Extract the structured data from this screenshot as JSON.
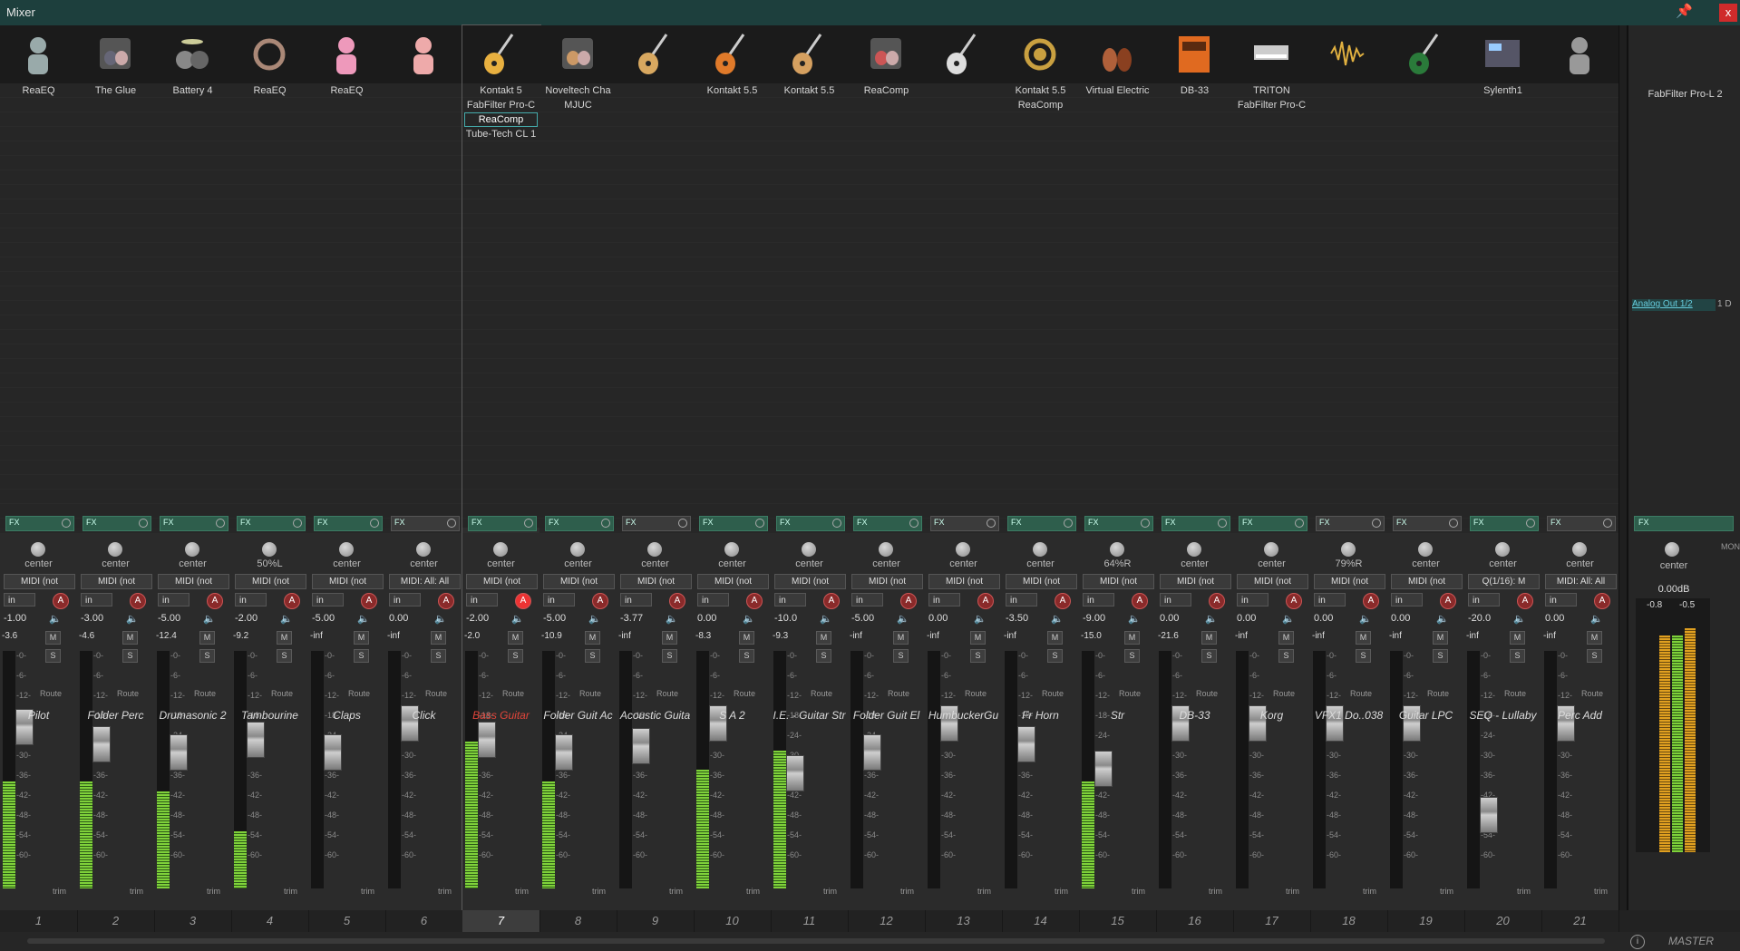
{
  "window": {
    "title": "Mixer",
    "pin_icon": "pin-icon",
    "close_label": "x"
  },
  "tracks": [
    {
      "num": "1",
      "name": "Pilot",
      "fx": [
        "ReaEQ"
      ],
      "pan": "center",
      "midi": "MIDI (not",
      "vol": "-1.00",
      "peak": "-3.6",
      "armed": false,
      "meter": 0.45,
      "fader": 0.72,
      "icon": "mic",
      "fxon": true
    },
    {
      "num": "2",
      "name": "Folder Perc",
      "fx": [
        "The Glue"
      ],
      "pan": "center",
      "midi": "MIDI (not",
      "vol": "-3.00",
      "peak": "-4.6",
      "armed": false,
      "meter": 0.45,
      "fader": 0.64,
      "icon": "band",
      "fxon": true
    },
    {
      "num": "3",
      "name": "Drumasonic 2",
      "fx": [
        "Battery 4"
      ],
      "pan": "center",
      "midi": "MIDI (not",
      "vol": "-5.00",
      "peak": "-12.4",
      "armed": false,
      "meter": 0.41,
      "fader": 0.6,
      "icon": "drums",
      "fxon": true
    },
    {
      "num": "4",
      "name": "Tambourine",
      "fx": [
        "ReaEQ"
      ],
      "pan": "50%L",
      "midi": "MIDI (not",
      "vol": "-2.00",
      "peak": "-9.2",
      "armed": false,
      "meter": 0.24,
      "fader": 0.66,
      "icon": "tamb",
      "fxon": true
    },
    {
      "num": "5",
      "name": "Claps",
      "fx": [
        "ReaEQ"
      ],
      "pan": "center",
      "midi": "MIDI (not",
      "vol": "-5.00",
      "peak": "-inf",
      "armed": false,
      "meter": 0.0,
      "fader": 0.6,
      "icon": "claps",
      "fxon": true
    },
    {
      "num": "6",
      "name": "Click",
      "fx": [],
      "pan": "center",
      "midi": "MIDI: All: All",
      "vol": "0.00",
      "peak": "-inf",
      "armed": false,
      "meter": 0.0,
      "fader": 0.74,
      "icon": "hand",
      "fxon": false
    },
    {
      "num": "7",
      "name": "Bass Guitar",
      "fx": [
        "Kontakt 5",
        "FabFilter Pro-C",
        "ReaComp",
        "Tube-Tech CL 1"
      ],
      "pan": "center",
      "midi": "MIDI (not",
      "vol": "-2.00",
      "peak": "-2.0",
      "armed": true,
      "meter": 0.62,
      "fader": 0.66,
      "icon": "bass",
      "fxon": true
    },
    {
      "num": "8",
      "name": "Folder Guit Ac",
      "fx": [
        "Noveltech Cha",
        "MJUC"
      ],
      "pan": "center",
      "midi": "MIDI (not",
      "vol": "-5.00",
      "peak": "-10.9",
      "armed": false,
      "meter": 0.45,
      "fader": 0.6,
      "icon": "guitars",
      "fxon": true
    },
    {
      "num": "9",
      "name": "Acoustic Guita",
      "fx": [],
      "pan": "center",
      "midi": "MIDI (not",
      "vol": "-3.77",
      "peak": "-inf",
      "armed": false,
      "meter": 0.0,
      "fader": 0.63,
      "icon": "acoustic",
      "fxon": false
    },
    {
      "num": "10",
      "name": "S A 2",
      "fx": [
        "Kontakt 5.5"
      ],
      "pan": "center",
      "midi": "MIDI (not",
      "vol": "0.00",
      "peak": "-8.3",
      "armed": false,
      "meter": 0.5,
      "fader": 0.74,
      "icon": "orange",
      "fxon": true
    },
    {
      "num": "11",
      "name": "I.E. - Guitar Str",
      "fx": [
        "Kontakt 5.5"
      ],
      "pan": "center",
      "midi": "MIDI (not",
      "vol": "-10.0",
      "peak": "-9.3",
      "armed": false,
      "meter": 0.58,
      "fader": 0.5,
      "icon": "acoustic2",
      "fxon": true
    },
    {
      "num": "12",
      "name": "Folder Guit El",
      "fx": [
        "ReaComp"
      ],
      "pan": "center",
      "midi": "MIDI (not",
      "vol": "-5.00",
      "peak": "-inf",
      "armed": false,
      "meter": 0.0,
      "fader": 0.6,
      "icon": "electric",
      "fxon": true
    },
    {
      "num": "13",
      "name": "HumbuckerGu",
      "fx": [],
      "pan": "center",
      "midi": "MIDI (not",
      "vol": "0.00",
      "peak": "-inf",
      "armed": false,
      "meter": 0.0,
      "fader": 0.74,
      "icon": "strat",
      "fxon": false
    },
    {
      "num": "14",
      "name": "Fr Horn",
      "fx": [
        "Kontakt 5.5",
        "ReaComp"
      ],
      "pan": "center",
      "midi": "MIDI (not",
      "vol": "-3.50",
      "peak": "-inf",
      "armed": false,
      "meter": 0.0,
      "fader": 0.64,
      "icon": "horn",
      "fxon": true
    },
    {
      "num": "15",
      "name": "Str",
      "fx": [
        "Virtual Electric"
      ],
      "pan": "64%R",
      "midi": "MIDI (not",
      "vol": "-9.00",
      "peak": "-15.0",
      "armed": false,
      "meter": 0.45,
      "fader": 0.52,
      "icon": "strings",
      "fxon": true
    },
    {
      "num": "16",
      "name": "DB-33",
      "fx": [
        "DB-33"
      ],
      "pan": "center",
      "midi": "MIDI (not",
      "vol": "0.00",
      "peak": "-21.6",
      "armed": false,
      "meter": 0.0,
      "fader": 0.74,
      "icon": "organ",
      "fxon": true
    },
    {
      "num": "17",
      "name": "Korg",
      "fx": [
        "TRITON",
        "FabFilter Pro-C"
      ],
      "pan": "center",
      "midi": "MIDI (not",
      "vol": "0.00",
      "peak": "-inf",
      "armed": false,
      "meter": 0.0,
      "fader": 0.74,
      "icon": "keys",
      "fxon": true
    },
    {
      "num": "18",
      "name": "VFX1 Do..038",
      "fx": [],
      "pan": "79%R",
      "midi": "MIDI (not",
      "vol": "0.00",
      "peak": "-inf",
      "armed": false,
      "meter": 0.0,
      "fader": 0.74,
      "icon": "wave",
      "fxon": false
    },
    {
      "num": "19",
      "name": "Guitar LPC",
      "fx": [],
      "pan": "center",
      "midi": "MIDI (not",
      "vol": "0.00",
      "peak": "-inf",
      "armed": false,
      "meter": 0.0,
      "fader": 0.74,
      "icon": "lp",
      "fxon": false
    },
    {
      "num": "20",
      "name": "SEQ - Lullaby",
      "fx": [
        "Sylenth1"
      ],
      "pan": "center",
      "midi": "Q(1/16): M",
      "vol": "-20.0",
      "peak": "-inf",
      "armed": false,
      "meter": 0.0,
      "fader": 0.3,
      "icon": "synth",
      "fxon": true
    },
    {
      "num": "21",
      "name": "Perc Add",
      "fx": [],
      "pan": "center",
      "midi": "MIDI: All: All",
      "vol": "0.00",
      "peak": "-inf",
      "armed": false,
      "meter": 0.0,
      "fader": 0.74,
      "icon": "person",
      "fxon": false
    }
  ],
  "labels": {
    "fx": "FX",
    "in": "in",
    "route": "Route",
    "trim": "trim",
    "M": "M",
    "S": "S",
    "arm": "A"
  },
  "scale": [
    "-0-",
    "-6-",
    "-12-",
    "-18-",
    "-24-",
    "-30-",
    "-36-",
    "-42-",
    "-48-",
    "-54-",
    "-60-"
  ],
  "master": {
    "fx": "FabFilter Pro-L 2",
    "output": "Analog Out 1/2",
    "output_rest": "1 D",
    "pan": "center",
    "vol": "0.00dB",
    "peak_l": "-0.8",
    "peak_r": "-0.5",
    "mono": "MONO",
    "label": "MASTER",
    "meter_l": 0.92,
    "meter_r": 0.95
  },
  "colors": {
    "fx_on": "#2e5e4c",
    "meter_green": "#7fd13a",
    "selected_name": "#e0453a",
    "titlebar": "#1d3f3d"
  }
}
